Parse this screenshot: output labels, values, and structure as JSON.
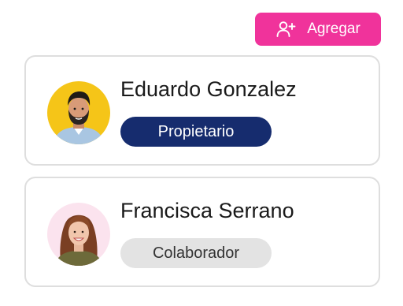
{
  "toolbar": {
    "add_label": "Agregar",
    "add_icon": "add-user-icon",
    "accent_color": "#f0339b"
  },
  "members": [
    {
      "name": "Eduardo Gonzalez",
      "role": "Propietario",
      "role_color": "#162c6e",
      "avatar_bg": "#f5c518"
    },
    {
      "name": "Francisca Serrano",
      "role": "Colaborador",
      "role_color": "#e3e3e3",
      "avatar_bg": "#fbe3ee"
    }
  ]
}
